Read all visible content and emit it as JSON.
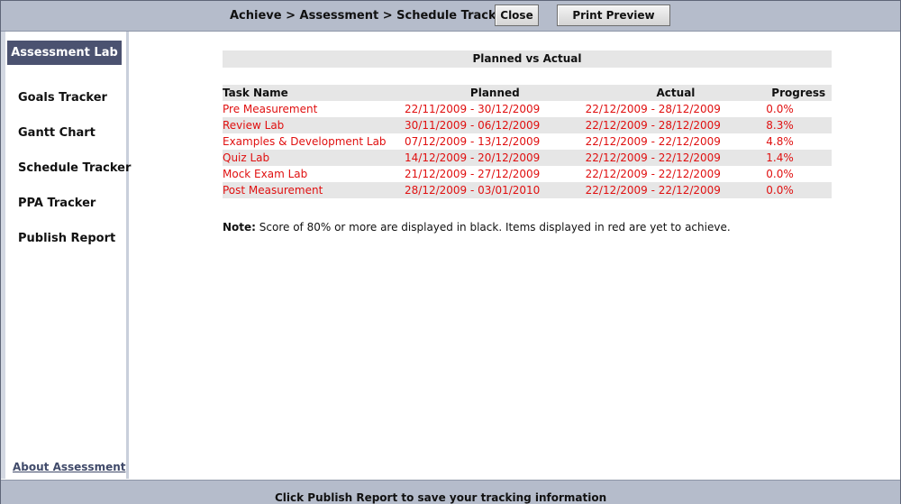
{
  "header": {
    "breadcrumb": "Achieve > Assessment > Schedule Tracker",
    "close_label": "Close",
    "print_label": "Print Preview"
  },
  "sidebar": {
    "active_label": "Assessment Lab",
    "items": [
      {
        "label": "Goals Tracker"
      },
      {
        "label": "Gantt Chart"
      },
      {
        "label": "Schedule Tracker"
      },
      {
        "label": "PPA Tracker"
      },
      {
        "label": "Publish Report"
      }
    ],
    "about_label": "About Assessment"
  },
  "main": {
    "table_title": "Planned vs Actual",
    "columns": [
      "Task Name",
      "Planned",
      "Actual",
      "Progress"
    ],
    "rows": [
      {
        "task": "Pre Measurement",
        "planned": "22/11/2009 - 30/12/2009",
        "actual": "22/12/2009 - 28/12/2009",
        "progress": "0.0%"
      },
      {
        "task": "Review Lab",
        "planned": "30/11/2009 - 06/12/2009",
        "actual": "22/12/2009 - 28/12/2009",
        "progress": "8.3%"
      },
      {
        "task": "Examples & Development Lab",
        "planned": "07/12/2009 - 13/12/2009",
        "actual": "22/12/2009 - 22/12/2009",
        "progress": "4.8%"
      },
      {
        "task": "Quiz Lab",
        "planned": "14/12/2009 - 20/12/2009",
        "actual": "22/12/2009 - 22/12/2009",
        "progress": "1.4%"
      },
      {
        "task": "Mock Exam Lab",
        "planned": "21/12/2009 - 27/12/2009",
        "actual": "22/12/2009 - 22/12/2009",
        "progress": "0.0%"
      },
      {
        "task": "Post Measurement",
        "planned": "28/12/2009 - 03/01/2010",
        "actual": "22/12/2009 - 22/12/2009",
        "progress": "0.0%"
      }
    ],
    "note_label": "Note:",
    "note_text": " Score of 80% or more are displayed in black. Items displayed in red are yet to achieve."
  },
  "footer": {
    "message": "Click Publish Report to save your tracking information"
  },
  "colors": {
    "header_bg": "#b5bccb",
    "active_bg": "#4b5270",
    "row_alt_bg": "#e6e6e6",
    "not_achieved": "#e01010",
    "achieved": "#111111"
  }
}
